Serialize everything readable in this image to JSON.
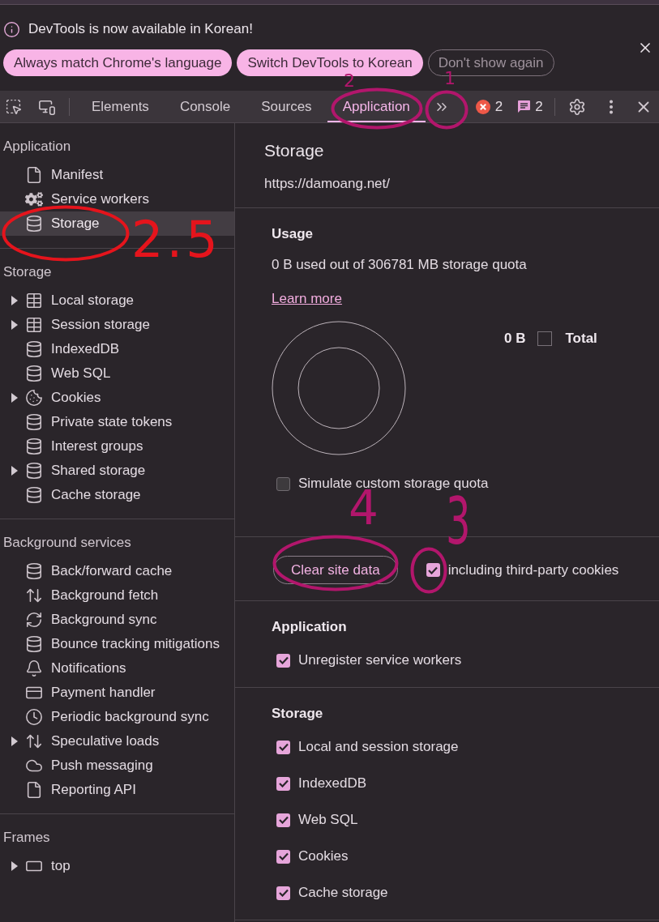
{
  "infobar": {
    "message": "DevTools is now available in Korean!",
    "buttons": [
      {
        "label": "Always match Chrome's language",
        "kind": "primary"
      },
      {
        "label": "Switch DevTools to Korean",
        "kind": "primary"
      },
      {
        "label": "Don't show again",
        "kind": "outline"
      }
    ]
  },
  "toolbar": {
    "tabs": [
      {
        "label": "Elements",
        "selected": false
      },
      {
        "label": "Console",
        "selected": false
      },
      {
        "label": "Sources",
        "selected": false
      },
      {
        "label": "Application",
        "selected": true
      }
    ],
    "error_count": "2",
    "message_count": "2"
  },
  "sidebar": {
    "sections": [
      {
        "title": "Application",
        "items": [
          {
            "label": "Manifest",
            "selected": false
          },
          {
            "label": "Service workers",
            "selected": false
          },
          {
            "label": "Storage",
            "selected": true
          }
        ]
      },
      {
        "title": "Storage",
        "items": [
          {
            "label": "Local storage",
            "expanded": false,
            "selected": false
          },
          {
            "label": "Session storage",
            "expanded": false,
            "selected": false
          },
          {
            "label": "IndexedDB",
            "selected": false
          },
          {
            "label": "Web SQL",
            "selected": false
          },
          {
            "label": "Cookies",
            "expanded": false,
            "selected": false
          },
          {
            "label": "Private state tokens",
            "selected": false
          },
          {
            "label": "Interest groups",
            "selected": false
          },
          {
            "label": "Shared storage",
            "expanded": false,
            "selected": false
          },
          {
            "label": "Cache storage",
            "selected": false
          }
        ]
      },
      {
        "title": "Background services",
        "items": [
          {
            "label": "Back/forward cache",
            "selected": false
          },
          {
            "label": "Background fetch",
            "selected": false
          },
          {
            "label": "Background sync",
            "selected": false
          },
          {
            "label": "Bounce tracking mitigations",
            "selected": false
          },
          {
            "label": "Notifications",
            "selected": false
          },
          {
            "label": "Payment handler",
            "selected": false
          },
          {
            "label": "Periodic background sync",
            "selected": false
          },
          {
            "label": "Speculative loads",
            "expanded": false,
            "selected": false
          },
          {
            "label": "Push messaging",
            "selected": false
          },
          {
            "label": "Reporting API",
            "selected": false
          }
        ]
      },
      {
        "title": "Frames",
        "items": [
          {
            "label": "top",
            "expanded": false,
            "selected": false
          }
        ]
      }
    ]
  },
  "panel": {
    "title": "Storage",
    "origin": "https://damoang.net/",
    "usage": {
      "heading": "Usage",
      "summary": "0 B used out of 306781 MB storage quota",
      "link": "Learn more",
      "legend_value": "0 B",
      "legend_label": "Total"
    },
    "simulate_quota": {
      "label": "Simulate custom storage quota",
      "checked": false
    },
    "clear_button": "Clear site data",
    "third_party": {
      "label": "including third-party cookies",
      "checked": true
    },
    "groups": [
      {
        "heading": "Application",
        "options": [
          {
            "label": "Unregister service workers",
            "checked": true
          }
        ]
      },
      {
        "heading": "Storage",
        "options": [
          {
            "label": "Local and session storage",
            "checked": true
          },
          {
            "label": "IndexedDB",
            "checked": true
          },
          {
            "label": "Web SQL",
            "checked": true
          },
          {
            "label": "Cookies",
            "checked": true
          },
          {
            "label": "Cache storage",
            "checked": true
          }
        ]
      }
    ]
  },
  "annotations": [
    {
      "label": "2",
      "color": "#b2166c"
    },
    {
      "label": "1",
      "color": "#b2166c"
    },
    {
      "label": "2.5",
      "color": "#e5141c"
    },
    {
      "label": "4",
      "color": "#b2166c"
    },
    {
      "label": "3",
      "color": "#b2166c"
    }
  ]
}
